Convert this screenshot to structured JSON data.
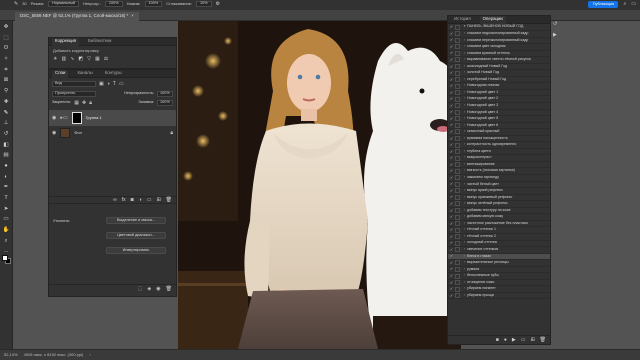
{
  "menubar": {
    "items": [
      "Файл",
      "Редактирование",
      "Изображение",
      "Слои",
      "Текст",
      "Выделение",
      "Фильтр",
      "3D",
      "Просмотр",
      "Плагины",
      "Окно",
      "Справка"
    ],
    "publish": "Публикация"
  },
  "options": {
    "brush_size": "30",
    "mode_label": "Режим:",
    "mode": "Нормальный",
    "opacity_label": "Непрозр.:",
    "opacity": "100%",
    "flow_label": "Нажим:",
    "flow": "100%",
    "smooth_label": "Сглаживание:",
    "smooth": "10%"
  },
  "document": {
    "tab": "DSC_5559.NEF @ 52,1% (Группа 1, Слой-маска/16) *"
  },
  "status": {
    "zoom": "52,14%",
    "info": "4928 пикс. x 8192 пикс. (300 ppi)"
  },
  "correction": {
    "tabs": [
      "Коррекция",
      "Библиотеки"
    ],
    "hint": "Добавить корректировку"
  },
  "layers": {
    "tabs": [
      "Слои",
      "Каналы",
      "Контуры"
    ],
    "filter": "Вид",
    "blend": "Пропустить",
    "opacity_label": "Непрозрачность:",
    "opacity": "100%",
    "lock_label": "Закрепить:",
    "fill_label": "Заливка:",
    "fill": "100%",
    "items": [
      {
        "name": "Группа 1"
      },
      {
        "name": "Фон"
      }
    ],
    "refine_label": "Уточнить:",
    "buttons": [
      "Выделение и маска...",
      "Цветовой диапазон...",
      "Инвертировать"
    ]
  },
  "actions": {
    "tabs": [
      "История",
      "Операции"
    ],
    "set": "ПАНЕЛЬ ЭКШЕНОВ НОВЫЙ ГОД",
    "items": [
      "спасаем недоэкспонированный кадр",
      "спасаем переэкспонированный кадр",
      "спасаем цвет исходник",
      "спасаем красный оттенок",
      "выравнивание светло-тёмной рисунок",
      "шоколадный Новый Год",
      "золотой Новый Год",
      "серебряный Новый Год",
      "Новогодняя ночная",
      "Новогодний цвет 1",
      "Новогодний цвет 2",
      "Новогодний цвет 3",
      "Новогодний цвет 4",
      "Новогодний цвет 5",
      "Новогодний цвет 6",
      "сказочный красный",
      "красивая насыщенность",
      "контрастность одновременно",
      "глубина цвета",
      "микроконтраст",
      "винтажирование",
      "мягкость (похожая картинка)",
      "зажигаем гирлянду",
      "чистый белый цвет",
      "минус яркий рефлекс",
      "минус оранжевый рефлекс",
      "минус зелёный рефлекс",
      "добавим текстуру на коже",
      "добавим мягкую кожу",
      "частотное разложение без пластика",
      "тёплый оттенок 1",
      "тёплый оттенок 2",
      "холодный оттенок",
      "свечение оттенков",
      "блеск в глазах",
      "выразительные ресницы",
      "румяна",
      "белоснежные зубы",
      "отчищение кожи",
      "убираем пигмент",
      "убираем прыщи"
    ],
    "selected": 34
  },
  "colors": {
    "accent": "#1473e6",
    "panel": "#323232",
    "canvas": "#535353"
  }
}
